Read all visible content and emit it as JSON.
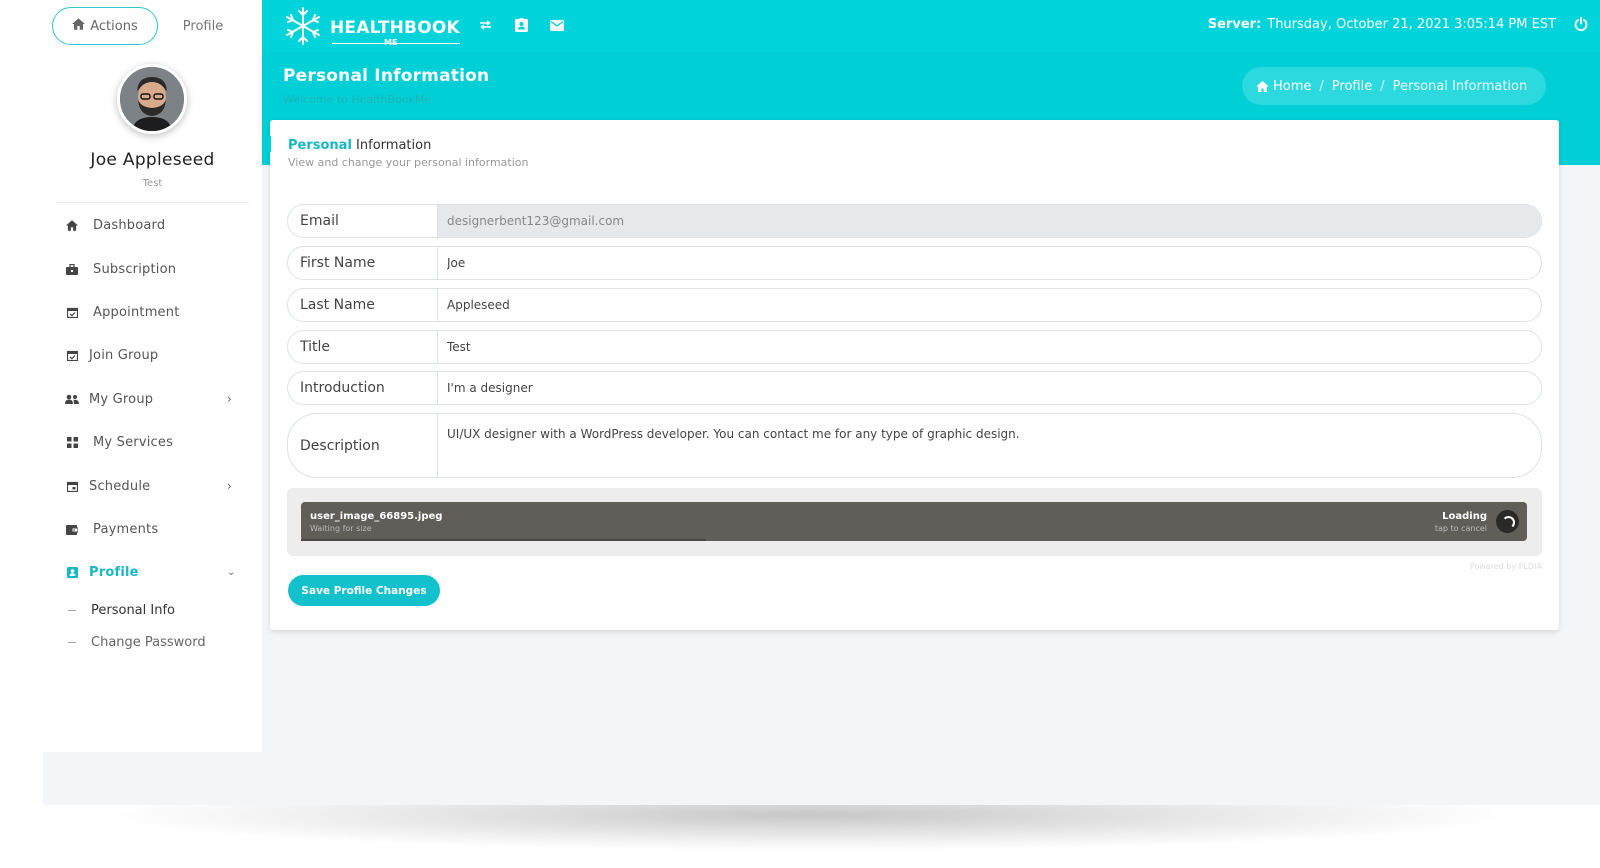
{
  "sidebar": {
    "tabs": {
      "actions": "Actions",
      "profile": "Profile"
    },
    "user": {
      "name": "Joe Appleseed",
      "subtitle": "Test"
    },
    "menu": [
      {
        "label": "Dashboard",
        "icon": "home-icon"
      },
      {
        "label": "Subscription",
        "icon": "briefcase-icon"
      },
      {
        "label": "Appointment",
        "icon": "calendar-check-icon"
      },
      {
        "label": "Join Group",
        "icon": "calendar-check-icon"
      },
      {
        "label": "My Group",
        "icon": "users-icon",
        "expandable": true
      },
      {
        "label": "My Services",
        "icon": "grid-icon"
      },
      {
        "label": "Schedule",
        "icon": "calendar-icon",
        "expandable": true
      },
      {
        "label": "Payments",
        "icon": "wallet-icon"
      },
      {
        "label": "Profile",
        "icon": "id-badge-icon",
        "expandable": true,
        "expanded": true,
        "active": true
      }
    ],
    "profile_submenu": [
      {
        "label": "Personal Info",
        "active": true
      },
      {
        "label": "Change Password"
      }
    ]
  },
  "topbar": {
    "logo": {
      "name": "HEALTHBOOK",
      "sub": "ME"
    },
    "icons": [
      "swap-icon",
      "id-badge-icon",
      "mail-icon"
    ],
    "server_label": "Server:",
    "server_time": "Thursday, October 21, 2021 3:05:14 PM EST"
  },
  "header": {
    "title": "Personal Information",
    "subtitle": "Welcome to HealthBookMe",
    "breadcrumb": {
      "home": "Home",
      "profile": "Profile",
      "current": "Personal Information"
    }
  },
  "card": {
    "title_accent": "Personal",
    "title_rest": " Information",
    "subtitle": "View and change your personal information",
    "fields": {
      "email": {
        "label": "Email",
        "value": "designerbent123@gmail.com"
      },
      "first_name": {
        "label": "First Name",
        "value": "Joe"
      },
      "last_name": {
        "label": "Last Name",
        "value": "Appleseed"
      },
      "title": {
        "label": "Title",
        "value": "Test"
      },
      "introduction": {
        "label": "Introduction",
        "value": "I'm a designer"
      },
      "description": {
        "label": "Description",
        "value": "UI/UX designer with a WordPress developer. You can contact me for any type of graphic design."
      }
    },
    "upload": {
      "file_name": "user_image_66895.jpeg",
      "size_text": "Waiting for size",
      "status": "Loading",
      "cancel_hint": "tap to cancel",
      "progress": 0.33,
      "powered_by": "Powered by PLDIA"
    },
    "save_label": "Save Profile Changes"
  },
  "colors": {
    "brand": "#00d4da",
    "accent": "#17b7c3",
    "button": "#12c1cb"
  }
}
